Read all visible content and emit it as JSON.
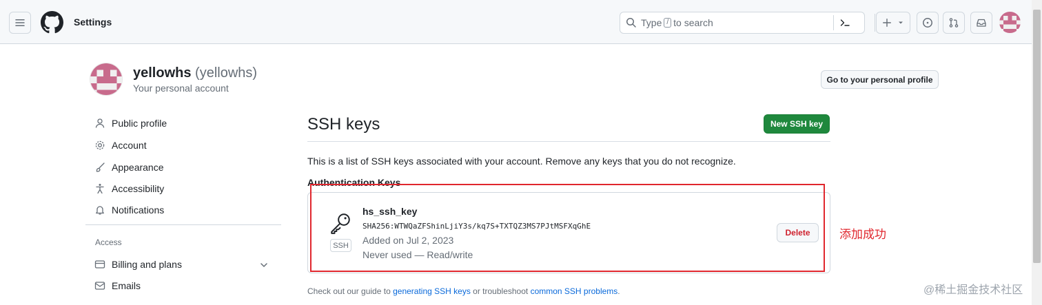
{
  "header": {
    "title": "Settings",
    "search": {
      "prefix": "Type",
      "key": "/",
      "suffix": "to search"
    }
  },
  "account": {
    "login": "yellowhs",
    "name": "(yellowhs)",
    "subtitle": "Your personal account",
    "profile_button": "Go to your personal profile"
  },
  "sidebar": {
    "items": [
      {
        "label": "Public profile",
        "icon": "person-icon"
      },
      {
        "label": "Account",
        "icon": "gear-icon"
      },
      {
        "label": "Appearance",
        "icon": "paintbrush-icon"
      },
      {
        "label": "Accessibility",
        "icon": "accessibility-icon"
      },
      {
        "label": "Notifications",
        "icon": "bell-icon"
      }
    ],
    "access_heading": "Access",
    "access_items": [
      {
        "label": "Billing and plans",
        "icon": "credit-card-icon"
      },
      {
        "label": "Emails",
        "icon": "mail-icon"
      }
    ]
  },
  "main": {
    "title": "SSH keys",
    "new_button": "New SSH key",
    "description": "This is a list of SSH keys associated with your account. Remove any keys that you do not recognize.",
    "auth_heading": "Authentication Keys",
    "key": {
      "type_label": "SSH",
      "title": "hs_ssh_key",
      "fingerprint": "SHA256:WTWQaZFShinLjiY3s/kq7S+TXTQZ3MS7PJtMSFXqGhE",
      "added": "Added on Jul 2, 2023",
      "usage": "Never used — Read/write",
      "delete_button": "Delete"
    },
    "annotation": "添加成功",
    "footer": {
      "prefix": "Check out our guide to",
      "link1": "generating SSH keys",
      "middle": "or troubleshoot",
      "link2": "common SSH problems",
      "suffix": "."
    }
  },
  "watermark": "@稀土掘金技术社区",
  "colors": {
    "primary_button": "#1f883d",
    "danger_text": "#cf222e",
    "link": "#0969da",
    "annotation_red": "#e0262d"
  }
}
